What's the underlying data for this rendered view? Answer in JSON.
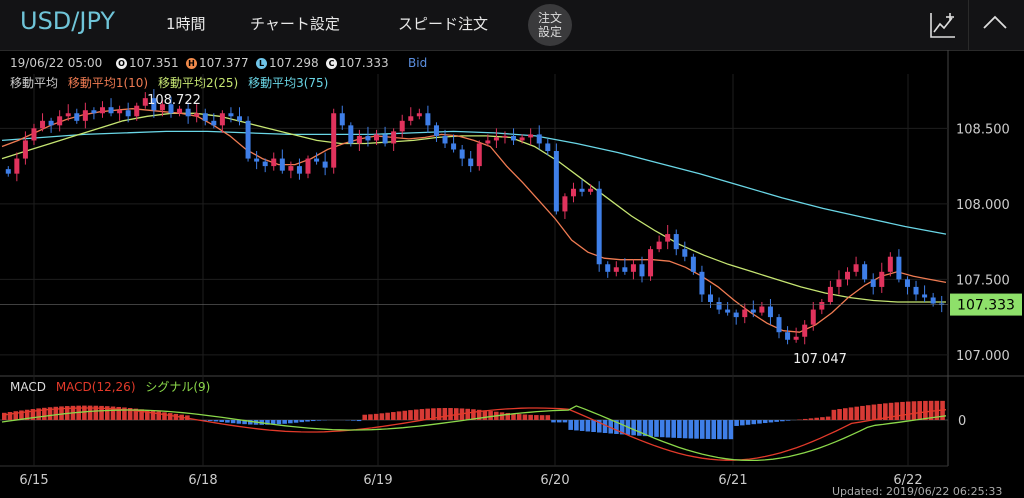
{
  "header": {
    "symbol": "USD/JPY",
    "menu": [
      "1時間",
      "チャート設定",
      "スピード注文"
    ],
    "order_button": [
      "注文",
      "設定"
    ]
  },
  "info": {
    "datetime": "19/06/22 05:00",
    "open": "107.351",
    "high": "107.377",
    "low": "107.298",
    "close": "107.333",
    "price_type": "Bid",
    "badges": {
      "open": "O",
      "high": "H",
      "low": "L",
      "close": "C"
    }
  },
  "indicators": {
    "ma_title": "移動平均",
    "ma1": "移動平均1(10)",
    "ma2": "移動平均2(25)",
    "ma3": "移動平均3(75)",
    "macd_title": "MACD",
    "macd": "MACD(12,26)",
    "signal": "シグナル(9)"
  },
  "colors": {
    "up": "#e0335d",
    "down": "#3f7fe8",
    "ma1": "#ef7b52",
    "ma2": "#c6e572",
    "ma3": "#6ad6e6",
    "macd_line": "#e23a2a",
    "signal_line": "#8bd84a",
    "price_tag": "#8ee06a",
    "accent": "#6fc4d8"
  },
  "chart_data": {
    "type": "candlestick",
    "timeframe": "1時間",
    "y_ticks": [
      "108.500",
      "108.000",
      "107.500",
      "107.000"
    ],
    "ylim": [
      106.86,
      108.86
    ],
    "x_ticks": [
      "6/15",
      "6/18",
      "6/19",
      "6/20",
      "6/21",
      "6/22"
    ],
    "annotations": {
      "high": "108.722",
      "low": "107.047",
      "last_price": "107.333"
    },
    "last_value": 107.333,
    "close_series": [
      108.2,
      108.3,
      108.42,
      108.5,
      108.55,
      108.52,
      108.58,
      108.6,
      108.55,
      108.62,
      108.6,
      108.64,
      108.6,
      108.62,
      108.58,
      108.65,
      108.7,
      108.62,
      108.66,
      108.6,
      108.63,
      108.58,
      108.6,
      108.55,
      108.52,
      108.6,
      108.58,
      108.55,
      108.3,
      108.28,
      108.25,
      108.3,
      108.22,
      108.25,
      108.2,
      108.3,
      108.28,
      108.24,
      108.6,
      108.52,
      108.4,
      108.45,
      108.42,
      108.46,
      108.4,
      108.48,
      108.55,
      108.58,
      108.6,
      108.52,
      108.45,
      108.4,
      108.36,
      108.3,
      108.25,
      108.4,
      108.42,
      108.44,
      108.45,
      108.42,
      108.44,
      108.46,
      108.4,
      108.35,
      107.95,
      108.05,
      108.1,
      108.08,
      108.1,
      107.6,
      107.55,
      107.58,
      107.55,
      107.6,
      107.52,
      107.7,
      107.75,
      107.8,
      107.7,
      107.65,
      107.55,
      107.4,
      107.35,
      107.3,
      107.28,
      107.25,
      107.3,
      107.28,
      107.32,
      107.25,
      107.15,
      107.1,
      107.12,
      107.2,
      107.3,
      107.35,
      107.45,
      107.5,
      107.55,
      107.6,
      107.5,
      107.45,
      107.55,
      107.65,
      107.5,
      107.45,
      107.4,
      107.38,
      107.34,
      107.333
    ],
    "ma1_series": [
      108.38,
      108.42,
      108.47,
      108.52,
      108.56,
      108.59,
      108.61,
      108.62,
      108.63,
      108.62,
      108.61,
      108.6,
      108.58,
      108.52,
      108.45,
      108.36,
      108.3,
      108.26,
      108.26,
      108.3,
      108.36,
      108.4,
      108.43,
      108.45,
      108.44,
      108.43,
      108.44,
      108.46,
      108.45,
      108.42,
      108.38,
      108.25,
      108.14,
      108.02,
      107.9,
      107.76,
      107.68,
      107.64,
      107.63,
      107.63,
      107.63,
      107.62,
      107.58,
      107.52,
      107.45,
      107.36,
      107.28,
      107.21,
      107.16,
      107.15,
      107.2,
      107.28,
      107.38,
      107.46,
      107.52,
      107.55,
      107.52,
      107.5,
      107.48
    ],
    "ma2_series": [
      108.3,
      108.35,
      108.4,
      108.45,
      108.5,
      108.55,
      108.58,
      108.6,
      108.6,
      108.58,
      108.54,
      108.5,
      108.46,
      108.42,
      108.4,
      108.4,
      108.41,
      108.42,
      108.44,
      108.45,
      108.45,
      108.44,
      108.38,
      108.28,
      108.16,
      108.04,
      107.92,
      107.82,
      107.73,
      107.66,
      107.6,
      107.55,
      107.5,
      107.45,
      107.41,
      107.38,
      107.36,
      107.35,
      107.35,
      107.35
    ],
    "ma3_series": [
      108.42,
      108.44,
      108.46,
      108.47,
      108.48,
      108.48,
      108.47,
      108.46,
      108.46,
      108.46,
      108.47,
      108.48,
      108.47,
      108.45,
      108.4,
      108.34,
      108.27,
      108.2,
      108.12,
      108.04,
      107.97,
      107.91,
      107.85,
      107.8
    ],
    "macd_histogram_sign": "positive 6/15–6/18, mixed 6/18–6/19, positive 6/19–6/20, negative 6/20–6/21, positive near 6/22"
  },
  "footer": {
    "updated": "Updated: 2019/06/22 06:25:33"
  }
}
